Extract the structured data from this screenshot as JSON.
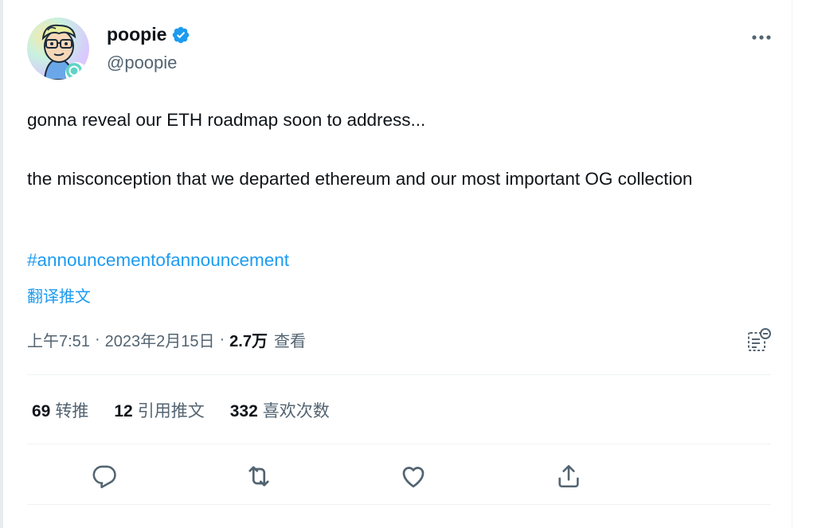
{
  "author": {
    "display_name": "poopie",
    "handle": "@poopie",
    "verified": true,
    "avatar_icon": "cartoon-avatar"
  },
  "tweet": {
    "line1": "gonna reveal our ETH roadmap soon to address...",
    "line2": "the misconception that we departed ethereum and our most important OG collection",
    "hashtag": "#announcementofannouncement",
    "translate_label": "翻译推文"
  },
  "meta": {
    "time": "上午7:51",
    "separator": "·",
    "date": "2023年2月15日",
    "views_count": "2.7万",
    "views_label": "查看"
  },
  "stats": {
    "retweets": {
      "count": "69",
      "label": "转推"
    },
    "quotes": {
      "count": "12",
      "label": "引用推文"
    },
    "likes": {
      "count": "332",
      "label": "喜欢次数"
    }
  },
  "colors": {
    "accent": "#1d9bf0",
    "secondary_text": "#536471",
    "primary_text": "#0f1419",
    "divider": "#eff3f4"
  },
  "icons": [
    "more-icon",
    "verified-badge-icon",
    "analytics-icon",
    "reply-icon",
    "retweet-icon",
    "like-icon",
    "share-icon"
  ]
}
